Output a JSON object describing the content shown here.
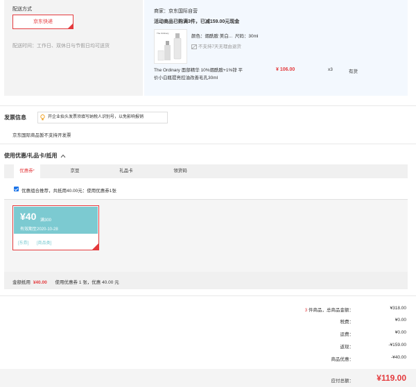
{
  "shipping": {
    "title": "配送方式",
    "option_label": "京东快递",
    "time_label": "配送时间：",
    "time_value": "工作日、双休日与节假日均可送货"
  },
  "merchant": {
    "name": "商家：京东国际自营",
    "promo": "活动商品已购满3件，已减159.00元现金"
  },
  "product": {
    "thumb_brand": "The Ordinary",
    "attrs_label": "颜色：",
    "color": "烟酰胺 美白...",
    "size_label": "尺码：",
    "size": "30ml",
    "return_note": "不支持7天无理由退货",
    "name_line1": "The Ordinary 面部精华 10%烟酰胺+1%锌 平",
    "name_line2": "价小白瓶提亮控油改善毛孔30ml",
    "price": "¥ 106.00",
    "qty": "x3",
    "stock": "有货"
  },
  "invoice": {
    "title": "发票信息",
    "tip": "开企业抬头发票须填写纳税人识别号，以免影响报销",
    "note": "京东国际商品暂不支持开发票"
  },
  "coupons": {
    "title": "使用优惠/礼品卡/抵用",
    "tabs": [
      {
        "label": "优惠券",
        "sup": "*"
      },
      {
        "label": "京豆"
      },
      {
        "label": "礼品卡"
      },
      {
        "label": "领货码"
      }
    ],
    "recommend_text": "优惠组合推荐，共抵用40.00元：使用优惠券1张",
    "coupon": {
      "amount": "¥40",
      "condition": "满300",
      "expiry": "有效期至2020-10-28",
      "tag1": "[东券]",
      "tag2": "[商品类]"
    },
    "deduct_label": "金额抵用",
    "deduct_value": "¥40.00",
    "deduct_desc": "使用优惠券 1 张，优惠 40.00 元"
  },
  "summary": {
    "count": "3",
    "count_label": "件商品，总商品金额：",
    "total_goods": "¥318.00",
    "rows": [
      {
        "label": "税费：",
        "value": "¥0.00"
      },
      {
        "label": "运费：",
        "value": "¥0.00"
      },
      {
        "label": "返现：",
        "value": "-¥159.00"
      },
      {
        "label": "商品优惠：",
        "value": "-¥40.00"
      }
    ],
    "payable_label": "应付总额：",
    "payable_value": "¥119.00"
  },
  "colors": {
    "accent": "#e4393c",
    "coupon": "#7ccad1",
    "check": "#1a73e8"
  }
}
